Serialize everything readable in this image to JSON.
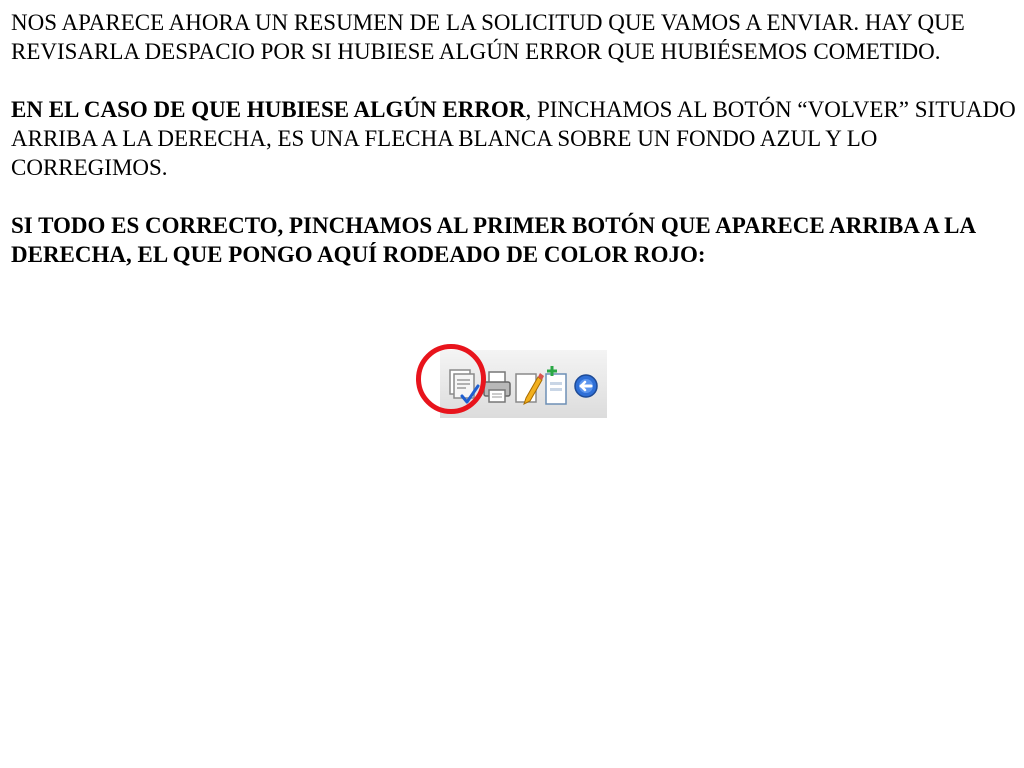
{
  "paragraph1": {
    "text": "NOS APARECE AHORA UN RESUMEN DE LA SOLICITUD QUE VAMOS A ENVIAR. HAY QUE REVISARLA DESPACIO POR SI HUBIESE ALGÚN ERROR QUE HUBIÉSEMOS COMETIDO."
  },
  "paragraph2": {
    "bold_lead": "EN EL CASO DE QUE HUBIESE ALGÚN ERROR",
    "rest": ", PINCHAMOS AL BOTÓN “VOLVER” SITUADO ARRIBA A LA DERECHA, ES UNA FLECHA BLANCA SOBRE UN FONDO AZUL Y LO CORREGIMOS."
  },
  "paragraph3": {
    "text": "SI TODO ES CORRECTO,  PINCHAMOS AL PRIMER BOTÓN QUE APARECE ARRIBA A LA DERECHA, EL QUE PONGO AQUÍ RODEADO DE COLOR ROJO:"
  },
  "toolbar": {
    "icons": [
      "confirm-document-icon",
      "print-icon",
      "edit-icon",
      "new-document-icon",
      "back-arrow-icon"
    ],
    "highlight_color": "#e8141c",
    "back_button_color": "#2f6fd6"
  }
}
